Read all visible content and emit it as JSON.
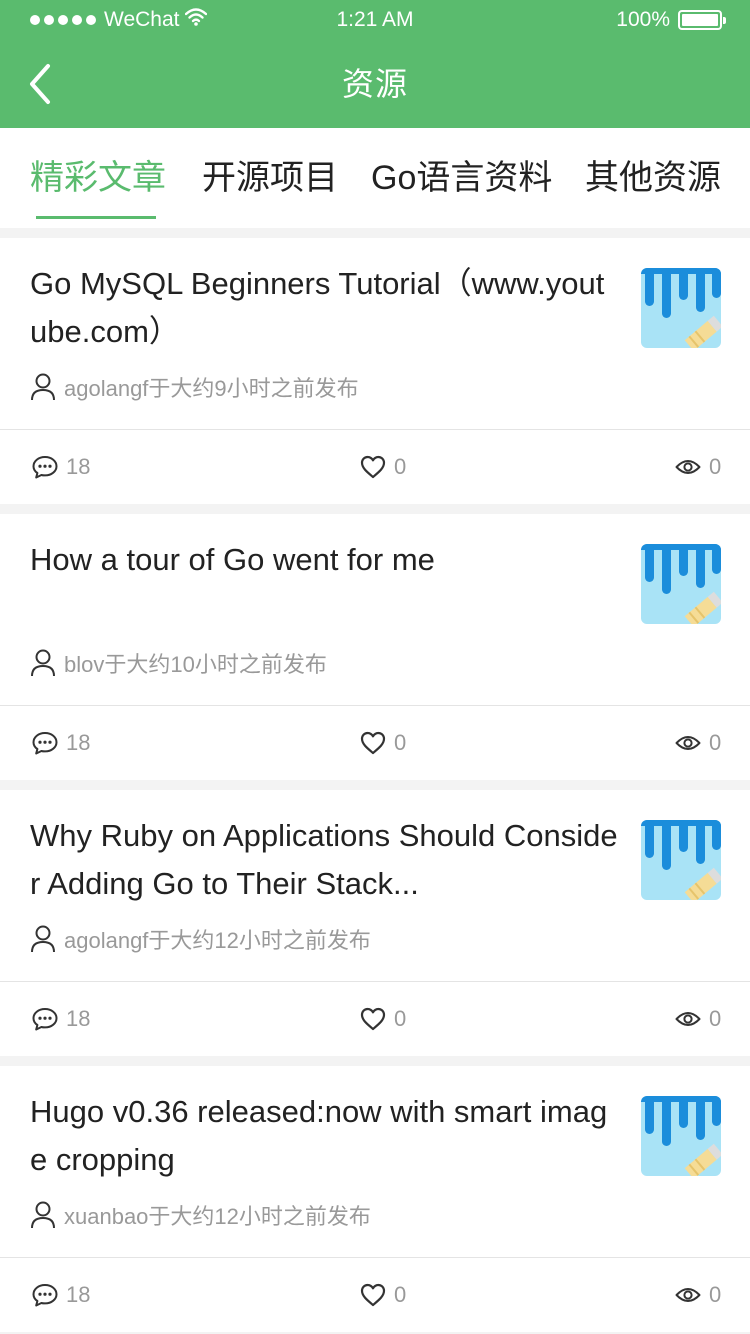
{
  "status_bar": {
    "carrier": "WeChat",
    "time": "1:21 AM",
    "battery": "100%"
  },
  "nav": {
    "title": "资源"
  },
  "tabs": [
    {
      "label": "精彩文章",
      "active": true
    },
    {
      "label": "开源项目",
      "active": false
    },
    {
      "label": "Go语言资料",
      "active": false
    },
    {
      "label": "其他资源",
      "active": false
    }
  ],
  "colors": {
    "brand_green": "#5abb6e",
    "thumb_bg": "#a9e3f6",
    "thumb_stripe": "#1b8ddb",
    "thumb_pencil": "#f5dc96"
  },
  "articles": [
    {
      "title": "Go MySQL Beginners Tutorial（www.youtube.com）",
      "meta": "agolangf于大约9小时之前发布",
      "comments": "18",
      "likes": "0",
      "views": "0",
      "thumb_icon": "thumbnail-image"
    },
    {
      "title": "How a tour of Go went for me",
      "meta": "blov于大约10小时之前发布",
      "comments": "18",
      "likes": "0",
      "views": "0",
      "thumb_icon": "thumbnail-image"
    },
    {
      "title": "Why Ruby on Applications Should Consider Adding Go to Their Stack...",
      "meta": "agolangf于大约12小时之前发布",
      "comments": "18",
      "likes": "0",
      "views": "0",
      "thumb_icon": "thumbnail-image"
    },
    {
      "title": "Hugo v0.36 released:now with smart image cropping",
      "meta": "xuanbao于大约12小时之前发布",
      "comments": "18",
      "likes": "0",
      "views": "0",
      "thumb_icon": "thumbnail-image"
    }
  ]
}
